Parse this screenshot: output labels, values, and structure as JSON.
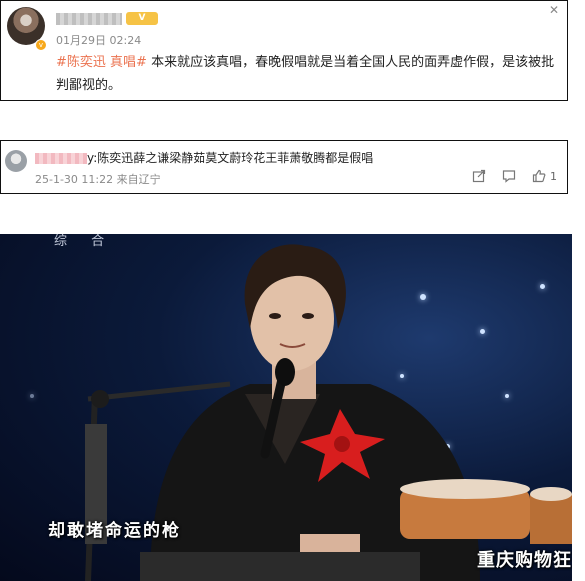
{
  "post": {
    "level_badge": "V",
    "timestamp": "01月29日 02:24",
    "hashtags": [
      "#陈奕迅 真唱#"
    ],
    "text_line1": "本来就应该真唱，春晚假唱就是当着全国人民的面弄虚作假，是该被批",
    "text_line2": "判鄙视的。",
    "close_glyph": "✕"
  },
  "reply": {
    "text": "y:陈奕迅薛之谦梁静茹莫文蔚玲花王菲萧敬腾都是假唱",
    "timestamp": "25-1-30 11:22 来自辽宁",
    "like_count": "1"
  },
  "video": {
    "watermark_top": "综 合",
    "subtitle": "却敢堵命运的枪",
    "watermark_br": "重庆购物狂"
  },
  "colors": {
    "hashtag": "#eb7350",
    "level_badge": "#f6c346",
    "vip": "#f7a81b"
  }
}
